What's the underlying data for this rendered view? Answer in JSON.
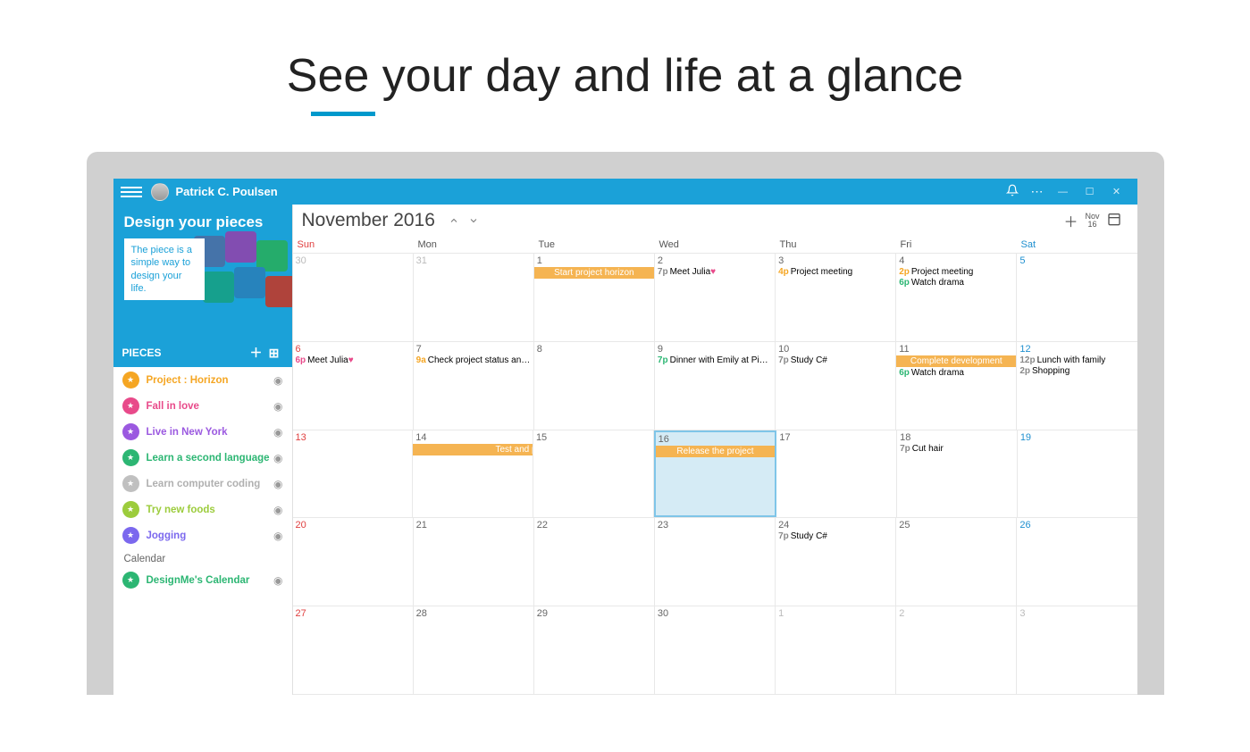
{
  "hero": {
    "title": "See your day and life at a glance"
  },
  "titlebar": {
    "username": "Patrick C. Poulsen"
  },
  "banner": {
    "title": "Design your pieces",
    "desc": "The piece is a simple way to design your life."
  },
  "pieces_header": {
    "label": "PIECES"
  },
  "pieces": [
    {
      "label": "Project : Horizon",
      "color": "#f5a623",
      "textcolor": "#f5a623"
    },
    {
      "label": "Fall in love",
      "color": "#e84a8a",
      "textcolor": "#e84a8a"
    },
    {
      "label": "Live in New York",
      "color": "#9b59e0",
      "textcolor": "#9b59e0"
    },
    {
      "label": "Learn a second language",
      "color": "#2cb673",
      "textcolor": "#2cb673"
    },
    {
      "label": "Learn computer coding",
      "color": "#c0c0c0",
      "textcolor": "#b0b0b0"
    },
    {
      "label": "Try new foods",
      "color": "#9ccc3c",
      "textcolor": "#9ccc3c"
    },
    {
      "label": "Jogging",
      "color": "#7b68ee",
      "textcolor": "#7b68ee"
    }
  ],
  "calendar_section": {
    "label": "Calendar"
  },
  "calendars": [
    {
      "label": "DesignMe's Calendar",
      "color": "#2cb673",
      "textcolor": "#2cb673"
    }
  ],
  "toolbar": {
    "month": "November 2016",
    "today_top": "Nov",
    "today_bottom": "16"
  },
  "dow": [
    "Sun",
    "Mon",
    "Tue",
    "Wed",
    "Thu",
    "Fri",
    "Sat"
  ],
  "weeks": [
    [
      {
        "num": "30",
        "cls": "other"
      },
      {
        "num": "31",
        "cls": "other"
      },
      {
        "num": "1",
        "bars": [
          {
            "text": "Start project horizon"
          }
        ]
      },
      {
        "num": "2",
        "events": [
          {
            "time": "7p",
            "tcolor": "#888",
            "text": "Meet Julia",
            "heart": true
          }
        ]
      },
      {
        "num": "3",
        "events": [
          {
            "time": "4p",
            "tcolor": "#f5a623",
            "text": "Project meeting"
          }
        ]
      },
      {
        "num": "4",
        "events": [
          {
            "time": "2p",
            "tcolor": "#f5a623",
            "text": "Project meeting"
          },
          {
            "time": "6p",
            "tcolor": "#2cb673",
            "text": "Watch drama"
          }
        ]
      },
      {
        "num": "5",
        "cls": "sat"
      }
    ],
    [
      {
        "num": "6",
        "cls": "sun",
        "events": [
          {
            "time": "6p",
            "tcolor": "#e84a8a",
            "text": "Meet Julia",
            "heart": true
          }
        ]
      },
      {
        "num": "7",
        "events": [
          {
            "time": "9a",
            "tcolor": "#f5a623",
            "text": "Check project status and meeting"
          }
        ]
      },
      {
        "num": "8"
      },
      {
        "num": "9",
        "events": [
          {
            "time": "7p",
            "tcolor": "#2cb673",
            "text": "Dinner with Emily at Pike street"
          }
        ]
      },
      {
        "num": "10",
        "events": [
          {
            "time": "7p",
            "tcolor": "#888",
            "text": "Study C#"
          }
        ]
      },
      {
        "num": "11",
        "bars": [
          {
            "text": "Complete development"
          }
        ],
        "events": [
          {
            "time": "6p",
            "tcolor": "#2cb673",
            "text": "Watch drama"
          }
        ]
      },
      {
        "num": "12",
        "cls": "sat",
        "events": [
          {
            "time": "12p",
            "tcolor": "#888",
            "text": "Lunch with family"
          },
          {
            "time": "2p",
            "tcolor": "#888",
            "text": "Shopping"
          }
        ]
      }
    ],
    [
      {
        "num": "13",
        "cls": "sun"
      },
      {
        "num": "14",
        "bars": [
          {
            "text": "Test and prepare for release",
            "span": true
          }
        ]
      },
      {
        "num": "15",
        "barcont": true
      },
      {
        "num": "16",
        "today": true,
        "bars": [
          {
            "text": "Release the project"
          }
        ]
      },
      {
        "num": "17"
      },
      {
        "num": "18",
        "events": [
          {
            "time": "7p",
            "tcolor": "#888",
            "text": "Cut hair"
          }
        ]
      },
      {
        "num": "19",
        "cls": "sat"
      }
    ],
    [
      {
        "num": "20",
        "cls": "sun"
      },
      {
        "num": "21"
      },
      {
        "num": "22"
      },
      {
        "num": "23"
      },
      {
        "num": "24",
        "events": [
          {
            "time": "7p",
            "tcolor": "#888",
            "text": "Study C#"
          }
        ]
      },
      {
        "num": "25"
      },
      {
        "num": "26",
        "cls": "sat"
      }
    ],
    [
      {
        "num": "27",
        "cls": "sun"
      },
      {
        "num": "28"
      },
      {
        "num": "29"
      },
      {
        "num": "30"
      },
      {
        "num": "1",
        "cls": "other"
      },
      {
        "num": "2",
        "cls": "other"
      },
      {
        "num": "3",
        "cls": "other"
      }
    ]
  ]
}
